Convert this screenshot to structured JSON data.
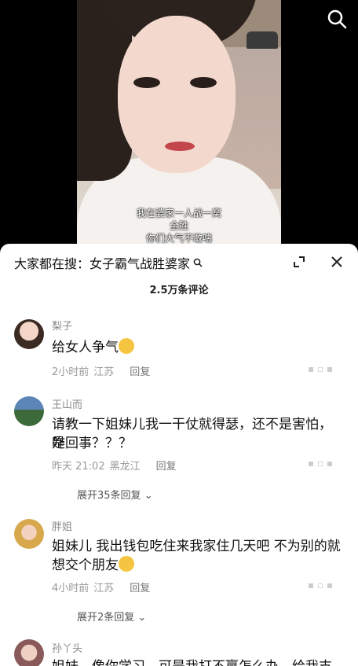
{
  "video": {
    "subtitle_line1": "我在婆家一人战一窝",
    "subtitle_line2": "全胜",
    "subtitle_line3": "你们大气不敢喘"
  },
  "sheet": {
    "search_prefix": "大家都在搜：",
    "search_query": "女子霸气战胜婆家",
    "comment_count": "2.5万条评论"
  },
  "comments": [
    {
      "user": "梨子",
      "text": "给女人争气",
      "time": "2小时前",
      "location": "江苏",
      "reply": "回复",
      "emoji": "thumbs-up-icon"
    },
    {
      "user": "王山而",
      "text_line1": "请教一下姐妹儿我一干仗就得瑟，还不是害怕，是",
      "text_line2": "咋回事？？？",
      "time": "昨天 21:02",
      "location": "黑龙江",
      "reply": "回复",
      "more": "展开35条回复"
    },
    {
      "user": "胖姐",
      "text_line1": "姐妹儿 我出钱包吃住来我家住几天吧 不为别的就",
      "text_line2": "想交个朋友",
      "time": "4小时前",
      "location": "江苏",
      "reply": "回复",
      "more": "展开2条回复",
      "emoji": "smile-icon"
    },
    {
      "user": "孙丫头",
      "text": "姐妹，像你学习，可是我打不赢怎么办，给我支"
    }
  ]
}
